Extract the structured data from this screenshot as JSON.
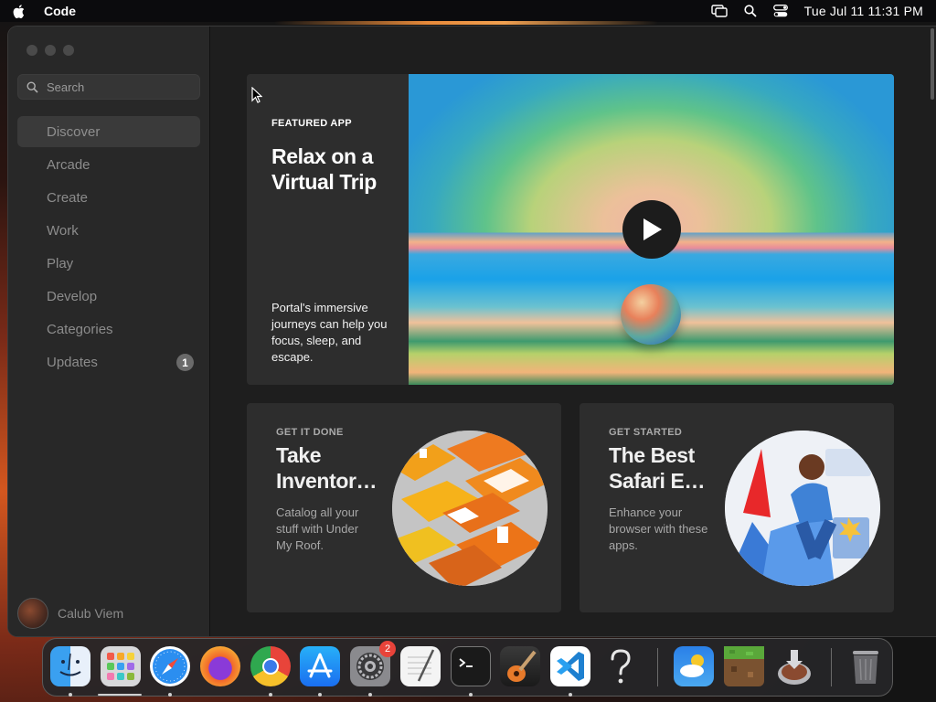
{
  "menubar": {
    "app_name": "Code",
    "clock": "Tue Jul 11  11:31 PM"
  },
  "sidebar": {
    "search_placeholder": "Search",
    "items": [
      {
        "label": "Discover",
        "active": true
      },
      {
        "label": "Arcade"
      },
      {
        "label": "Create"
      },
      {
        "label": "Work"
      },
      {
        "label": "Play"
      },
      {
        "label": "Develop"
      },
      {
        "label": "Categories"
      },
      {
        "label": "Updates",
        "badge": "1"
      }
    ],
    "user_name": "Calub Viem"
  },
  "featured": {
    "eyebrow": "FEATURED APP",
    "title": "Relax on a Virtual Trip",
    "description": "Portal's immersive journeys can help you focus, sleep, and escape."
  },
  "cards": [
    {
      "eyebrow": "GET IT DONE",
      "title_line1": "Take",
      "title_line2": "Inventor…",
      "description": "Catalog all your stuff with Under My Roof."
    },
    {
      "eyebrow": "GET STARTED",
      "title_line1": "The Best",
      "title_line2": "Safari E…",
      "description": "Enhance your browser with these apps."
    }
  ],
  "dock": {
    "settings_badge": "2",
    "apps": [
      "finder-icon",
      "launchpad-icon",
      "safari-icon",
      "firefox-icon",
      "chrome-icon",
      "app-store-icon",
      "system-settings-icon",
      "textedit-icon",
      "terminal-icon",
      "garageband-icon",
      "vscode-icon",
      "help-icon",
      "weather-icon",
      "minecraft-icon",
      "disk-utility-icon",
      "trash-icon"
    ]
  }
}
